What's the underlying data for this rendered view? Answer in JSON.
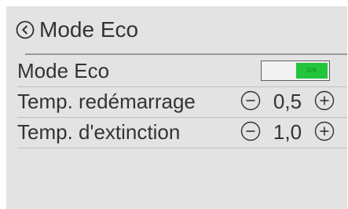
{
  "header": {
    "title": "Mode Eco",
    "back_icon": "chevron-left-circle-icon"
  },
  "settings": {
    "eco_mode": {
      "label": "Mode Eco",
      "toggle_state": "ON",
      "enabled": true
    },
    "restart_temp": {
      "label": "Temp. redémarrage",
      "value": "0,5",
      "decrement_icon": "minus-circle-icon",
      "increment_icon": "plus-circle-icon"
    },
    "shutdown_temp": {
      "label": "Temp. d'extinction",
      "value": "1,0",
      "decrement_icon": "minus-circle-icon",
      "increment_icon": "plus-circle-icon"
    }
  },
  "colors": {
    "panel_background": "#e3e3e3",
    "text": "#333333",
    "toggle_on": "#22c53c",
    "divider": "#c0c0c0"
  }
}
